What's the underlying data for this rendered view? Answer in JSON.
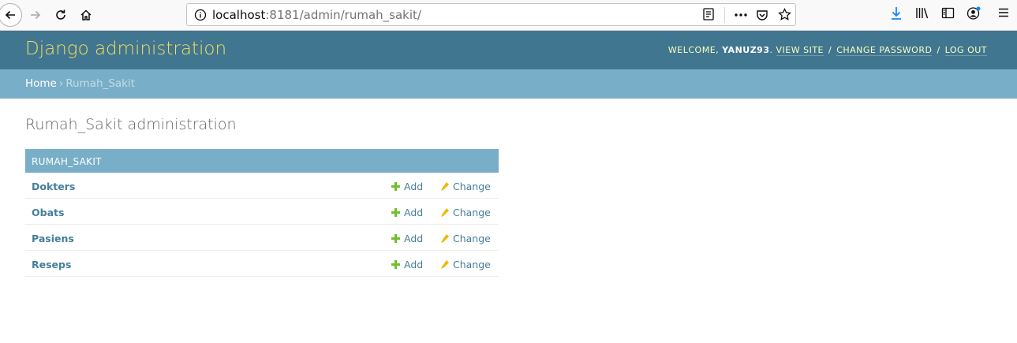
{
  "browser": {
    "url_host": "localhost",
    "url_path": ":8181/admin/rumah_sakit/"
  },
  "header": {
    "brand": "Django administration",
    "welcome": "WELCOME, ",
    "username": "YANUZ93",
    "period": ". ",
    "view_site": "VIEW SITE",
    "change_password": "CHANGE PASSWORD",
    "log_out": "LOG OUT",
    "separator": " / "
  },
  "breadcrumbs": {
    "home": "Home",
    "arrow": "›",
    "current": "Rumah_Sakit"
  },
  "page": {
    "title": "Rumah_Sakit administration"
  },
  "module": {
    "caption": "RUMAH_SAKIT",
    "add_label": "Add",
    "change_label": "Change",
    "models": [
      "Dokters",
      "Obats",
      "Pasiens",
      "Reseps"
    ]
  },
  "colors": {
    "header_bg": "#417690",
    "brand": "#f5dd5d",
    "breadcrumb_bg": "#79aec8",
    "link": "#447e9b",
    "add_icon": "#70bf2b",
    "change_icon": "#efb80b"
  },
  "icons": {
    "back": "back-arrow-icon",
    "forward": "forward-arrow-icon",
    "reload": "reload-icon",
    "home": "home-icon",
    "info": "info-icon",
    "reader": "reader-view-icon",
    "more": "more-actions-icon",
    "pocket": "pocket-icon",
    "bookmark": "bookmark-star-icon",
    "download": "download-icon",
    "library": "library-icon",
    "sidebar": "sidebar-icon",
    "account": "account-icon",
    "menu": "hamburger-menu-icon",
    "add": "plus-icon",
    "change": "pencil-icon"
  }
}
